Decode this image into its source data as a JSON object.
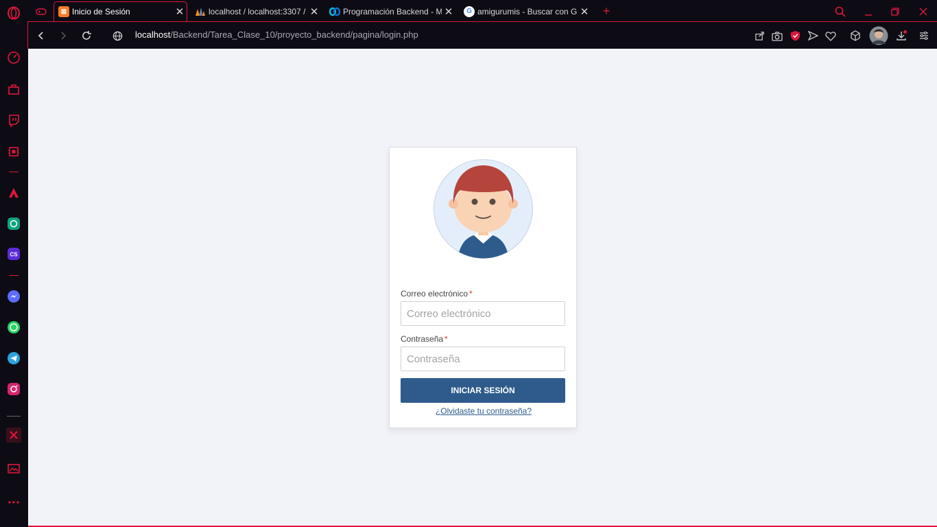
{
  "browser": {
    "tabs": [
      {
        "label": "Inicio de Sesión",
        "favicon": "xampp-icon",
        "active": true
      },
      {
        "label": "localhost / localhost:3307 / ",
        "favicon": "phpmyadmin-icon",
        "active": false
      },
      {
        "label": "Programación Backend - M",
        "favicon": "webex-icon",
        "active": false
      },
      {
        "label": "amigurumis - Buscar con G",
        "favicon": "google-icon",
        "active": false
      }
    ],
    "address": {
      "host": "localhost",
      "path": "/Backend/Tarea_Clase_10/proyecto_backend/pagina/login.php"
    },
    "accent_color": "#e0163c"
  },
  "login": {
    "email_label": "Correo electrónico",
    "email_required": "*",
    "email_placeholder": "Correo electrónico",
    "password_label": "Contraseña",
    "password_required": "*",
    "password_placeholder": "Contraseña",
    "submit_label": "INICIAR SESIÓN",
    "forgot_label": "¿Olvidaste tu contraseña?",
    "button_color": "#2e5b8c"
  }
}
